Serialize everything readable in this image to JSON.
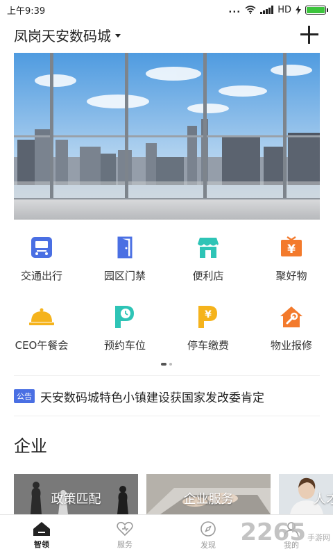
{
  "status_bar": {
    "time": "上午9:39",
    "dots": "...",
    "network": "HD",
    "battery_level": 1.0,
    "battery_color": "#3cc43c"
  },
  "header": {
    "location": "凤岗天安数码城",
    "add_icon": "plus-icon"
  },
  "banner": {
    "image": "city-skyline-balcony-photo"
  },
  "services": [
    {
      "label": "交通出行",
      "icon": "bus-icon",
      "color": "#4a6fe3"
    },
    {
      "label": "园区门禁",
      "icon": "door-icon",
      "color": "#4a6fe3"
    },
    {
      "label": "便利店",
      "icon": "shop-icon",
      "color": "#2ec4b6"
    },
    {
      "label": "聚好物",
      "icon": "yen-box-icon",
      "color": "#f37a2c"
    },
    {
      "label": "CEO午餐会",
      "icon": "cloche-icon",
      "color": "#f5b31c"
    },
    {
      "label": "预约车位",
      "icon": "parking-clock-icon",
      "color": "#2ec4b6"
    },
    {
      "label": "停车缴费",
      "icon": "parking-yen-icon",
      "color": "#f5b31c"
    },
    {
      "label": "物业报修",
      "icon": "house-wrench-icon",
      "color": "#f37a2c"
    }
  ],
  "pager": {
    "pages": 2,
    "current": 1
  },
  "notice": {
    "badge": "公告",
    "text": "天安数码城特色小镇建设获国家发改委肯定"
  },
  "enterprise": {
    "title": "企业",
    "cards": [
      {
        "label": "政策匹配",
        "image": "chess-pieces-photo"
      },
      {
        "label": "企业服务",
        "image": "laptop-typing-photo"
      },
      {
        "label": "人才",
        "image": "woman-portrait-photo"
      }
    ]
  },
  "bottom_nav": [
    {
      "label": "智领",
      "icon": "home-icon",
      "active": true
    },
    {
      "label": "服务",
      "icon": "heart-icon",
      "active": false
    },
    {
      "label": "发现",
      "icon": "compass-icon",
      "active": false
    },
    {
      "label": "我的",
      "icon": "user-icon",
      "active": false
    }
  ],
  "watermark": {
    "number": "2265",
    "text": "手游网"
  }
}
